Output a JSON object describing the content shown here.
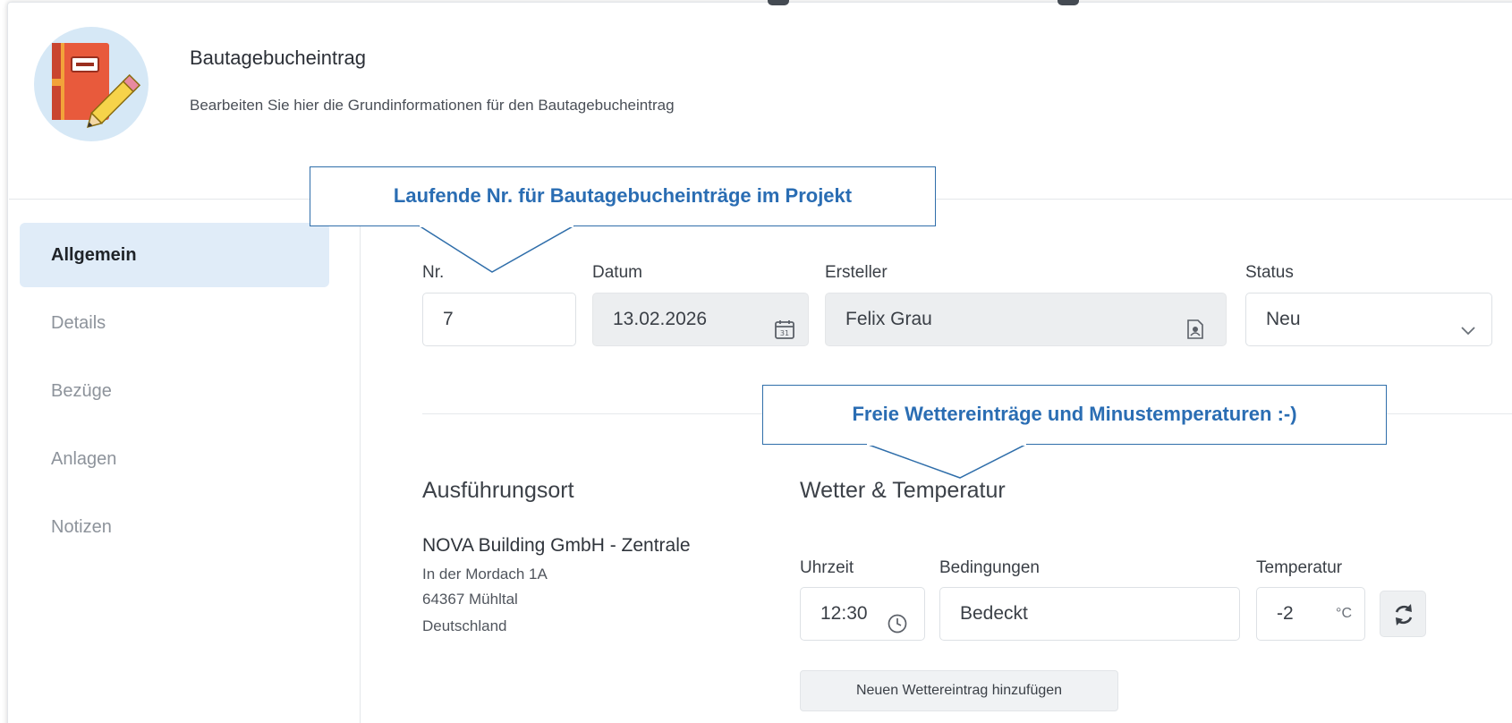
{
  "header": {
    "title": "Bautagebucheintrag",
    "subtitle": "Bearbeiten Sie hier die Grundinformationen für den Bautagebucheintrag",
    "icon": "diary-edit-icon"
  },
  "sidebar": {
    "items": [
      {
        "label": "Allgemein",
        "active": true
      },
      {
        "label": "Details",
        "active": false
      },
      {
        "label": "Bezüge",
        "active": false
      },
      {
        "label": "Anlagen",
        "active": false
      },
      {
        "label": "Notizen",
        "active": false
      }
    ]
  },
  "form": {
    "nr": {
      "label": "Nr.",
      "value": "7"
    },
    "datum": {
      "label": "Datum",
      "value": "13.02.2026",
      "icon": "calendar-icon"
    },
    "ersteller": {
      "label": "Ersteller",
      "value": "Felix Grau",
      "icon": "contact-card-icon"
    },
    "status": {
      "label": "Status",
      "value": "Neu",
      "icon": "chevron-down-icon"
    }
  },
  "location": {
    "title": "Ausführungsort",
    "name": "NOVA Building GmbH - Zentrale",
    "street": "In der Mordach 1A",
    "city": "64367 Mühltal",
    "country": "Deutschland"
  },
  "weather": {
    "title": "Wetter & Temperatur",
    "time_label": "Uhrzeit",
    "time_value": "12:30",
    "conditions_label": "Bedingungen",
    "conditions_value": "Bedeckt",
    "temperature_label": "Temperatur",
    "temperature_value": "-2",
    "temperature_unit": "°C",
    "add_button": "Neuen Wettereintrag hinzufügen"
  },
  "callouts": {
    "nr_hint": "Laufende Nr. für Bautagebucheinträge im Projekt",
    "weather_hint": "Freie Wettereinträge und Minustemperaturen :-)"
  },
  "colors": {
    "accent": "#2a6db3",
    "active_bg": "#e0ecf8",
    "icon_circle": "#d6e8f6"
  }
}
